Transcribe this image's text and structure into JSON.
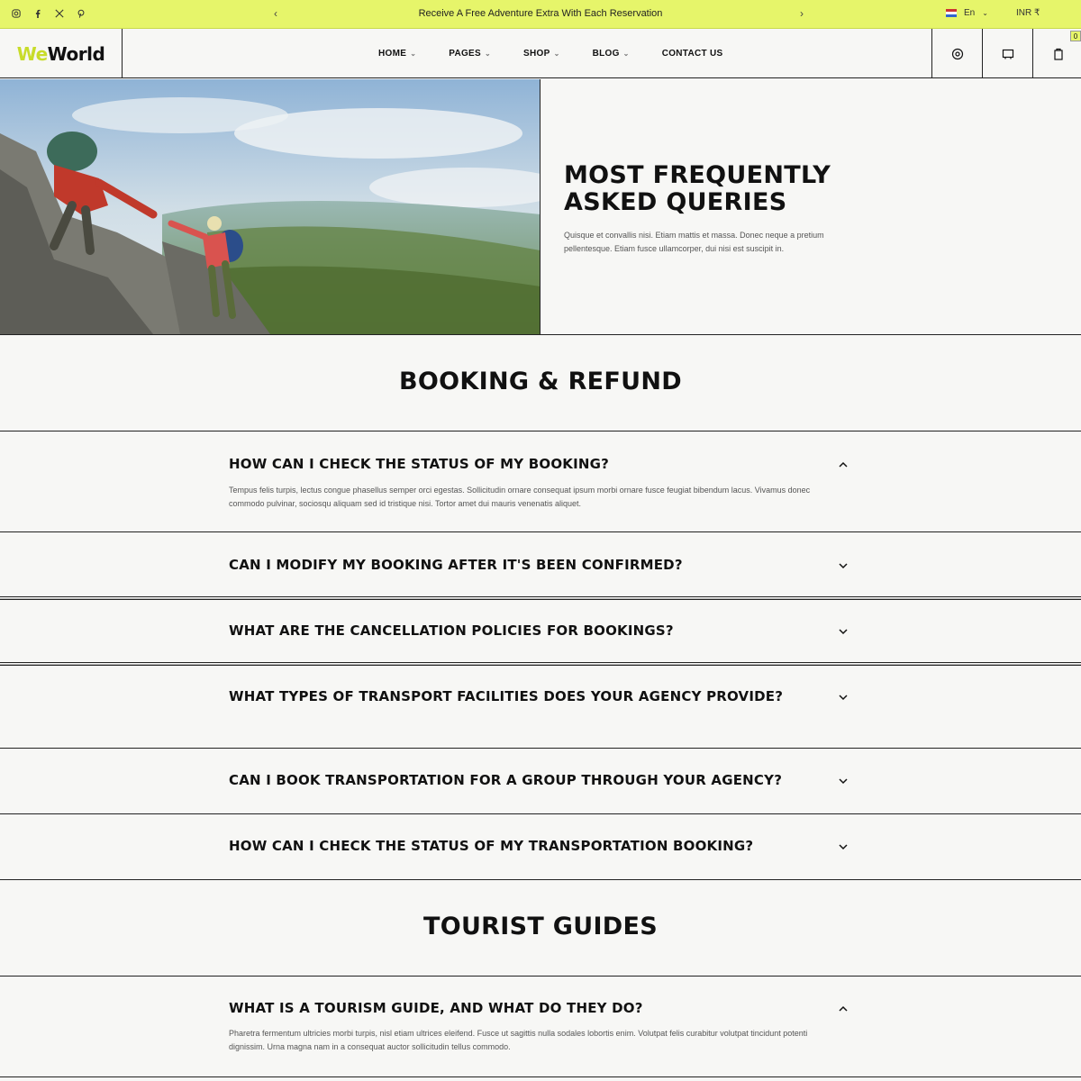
{
  "topbar": {
    "social": [
      "instagram-icon",
      "facebook-icon",
      "x-icon",
      "pinterest-icon"
    ],
    "prev_arrow": "‹",
    "next_arrow": "›",
    "promo": "Receive A Free Adventure Extra With Each Reservation",
    "language": "En",
    "currency": "INR ₹"
  },
  "header": {
    "logo_we": "We",
    "logo_world": "World",
    "nav": [
      {
        "label": "HOME",
        "has_dropdown": true
      },
      {
        "label": "PAGES",
        "has_dropdown": true
      },
      {
        "label": "SHOP",
        "has_dropdown": true
      },
      {
        "label": "BLOG",
        "has_dropdown": true
      },
      {
        "label": "CONTACT US",
        "has_dropdown": false
      }
    ],
    "cart_count": "0"
  },
  "hero": {
    "title": "MOST FREQUENTLY ASKED QUERIES",
    "description": "Quisque et convallis nisi. Etiam mattis et massa. Donec neque a pretium pellentesque. Etiam fusce ullamcorper, dui nisi est suscipit in."
  },
  "sections": [
    {
      "title": "BOOKING & REFUND",
      "faqs": [
        {
          "question": "HOW CAN I CHECK THE STATUS OF MY BOOKING?",
          "answer": "Tempus felis turpis, lectus congue phasellus semper orci egestas. Sollicitudin ornare consequat ipsum morbi ornare fusce feugiat bibendum lacus. Vivamus donec commodo pulvinar, sociosqu aliquam sed id tristique nisi. Tortor amet dui mauris venenatis aliquet.",
          "expanded": true
        },
        {
          "question": "CAN I MODIFY MY BOOKING AFTER IT'S BEEN CONFIRMED?",
          "answer": "",
          "expanded": false
        },
        {
          "question": "WHAT ARE THE CANCELLATION POLICIES FOR BOOKINGS?",
          "answer": "",
          "expanded": false
        },
        {
          "question": "WHAT TYPES OF TRANSPORT FACILITIES DOES YOUR AGENCY PROVIDE?",
          "answer": "",
          "expanded": false
        },
        {
          "question": "CAN I BOOK TRANSPORTATION FOR A GROUP THROUGH YOUR AGENCY?",
          "answer": "",
          "expanded": false
        },
        {
          "question": "HOW CAN I CHECK THE STATUS OF MY TRANSPORTATION BOOKING?",
          "answer": "",
          "expanded": false
        }
      ]
    },
    {
      "title": "TOURIST GUIDES",
      "faqs": [
        {
          "question": "WHAT IS A TOURISM GUIDE, AND WHAT DO THEY DO?",
          "answer": "Pharetra fermentum ultricies morbi turpis, nisl etiam ultrices eleifend. Fusce ut sagittis nulla sodales lobortis enim. Volutpat felis curabitur volutpat tincidunt potenti dignissim. Urna magna nam in a consequat auctor sollicitudin tellus commodo.",
          "expanded": true
        }
      ]
    }
  ],
  "colors": {
    "accent": "#e6f56a",
    "logo_accent": "#c8dc2a",
    "background": "#f7f7f5",
    "text": "#111111"
  }
}
